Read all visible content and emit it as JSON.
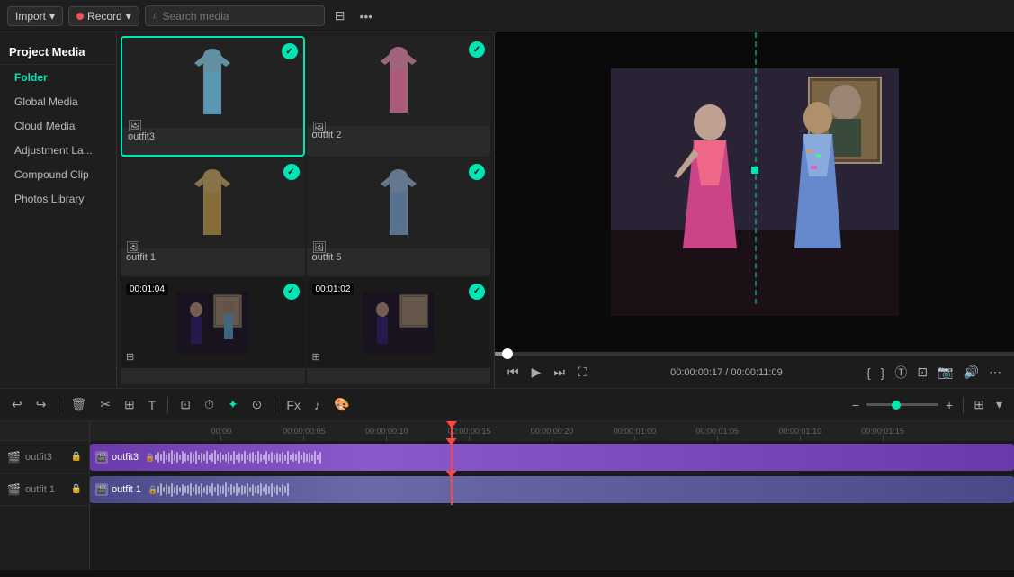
{
  "header": {
    "import_label": "Import",
    "record_label": "Record",
    "search_placeholder": "Search media"
  },
  "sidebar": {
    "title": "Project Media",
    "items": [
      {
        "label": "Folder",
        "id": "folder",
        "active": true,
        "highlighted": true
      },
      {
        "label": "Global Media",
        "id": "global-media"
      },
      {
        "label": "Cloud Media",
        "id": "cloud-media"
      },
      {
        "label": "Adjustment La...",
        "id": "adjustment-layer"
      },
      {
        "label": "Compound Clip",
        "id": "compound-clip"
      },
      {
        "label": "Photos Library",
        "id": "photos-library"
      }
    ]
  },
  "media_items": [
    {
      "id": "outfit3",
      "label": "outfit3",
      "selected": true,
      "has_check": true,
      "type": "image"
    },
    {
      "id": "outfit2",
      "label": "outfit 2",
      "selected": false,
      "has_check": true,
      "type": "image"
    },
    {
      "id": "outfit1",
      "label": "outfit 1",
      "selected": false,
      "has_check": true,
      "type": "image"
    },
    {
      "id": "outfit5",
      "label": "outfit 5",
      "selected": false,
      "has_check": true,
      "type": "image"
    },
    {
      "id": "video1",
      "label": "",
      "selected": false,
      "has_check": true,
      "type": "video",
      "duration": "00:01:04"
    },
    {
      "id": "video2",
      "label": "",
      "selected": false,
      "has_check": true,
      "type": "video",
      "duration": "00:01:02"
    }
  ],
  "preview": {
    "time_current": "00:00:00:17",
    "time_total": "00:00:11:09",
    "progress_pct": 2.6
  },
  "timeline": {
    "ruler_marks": [
      "00:00",
      "00:00:00:05",
      "00:00:00:10",
      "00:00:00:15",
      "00:00:00:20",
      "00:00:01:00",
      "00:00:01:05",
      "00:00:01:10",
      "00:00:01:15"
    ],
    "tracks": [
      {
        "label": "outfit3",
        "type": "video",
        "clip_label": "outfit3"
      },
      {
        "label": "outfit 1",
        "type": "video",
        "clip_label": "outfit 1"
      }
    ],
    "playhead_pct": 39
  },
  "icons": {
    "import_chevron": "▾",
    "record_dot": "●",
    "record_chevron": "▾",
    "search": "🔍",
    "filter": "⊟",
    "more": "•••",
    "play": "▶",
    "pause": "⏸",
    "rewind": "⏮",
    "forward": "⏭",
    "step_back": "⏪",
    "step_fwd": "⏩",
    "fullscreen": "⛶",
    "mark_in": "{",
    "mark_out": "}",
    "text": "T",
    "cut": "✂",
    "split": "⊞",
    "undo": "↩",
    "redo": "↪",
    "delete": "🗑",
    "crop": "⊡",
    "speed": "⏱",
    "effect": "✦",
    "snap": "⊙",
    "zoom_in": "+",
    "zoom_out": "−",
    "lock": "🔒",
    "eye": "👁",
    "speaker": "🔊",
    "add_track": "+",
    "grid": "⊞"
  }
}
